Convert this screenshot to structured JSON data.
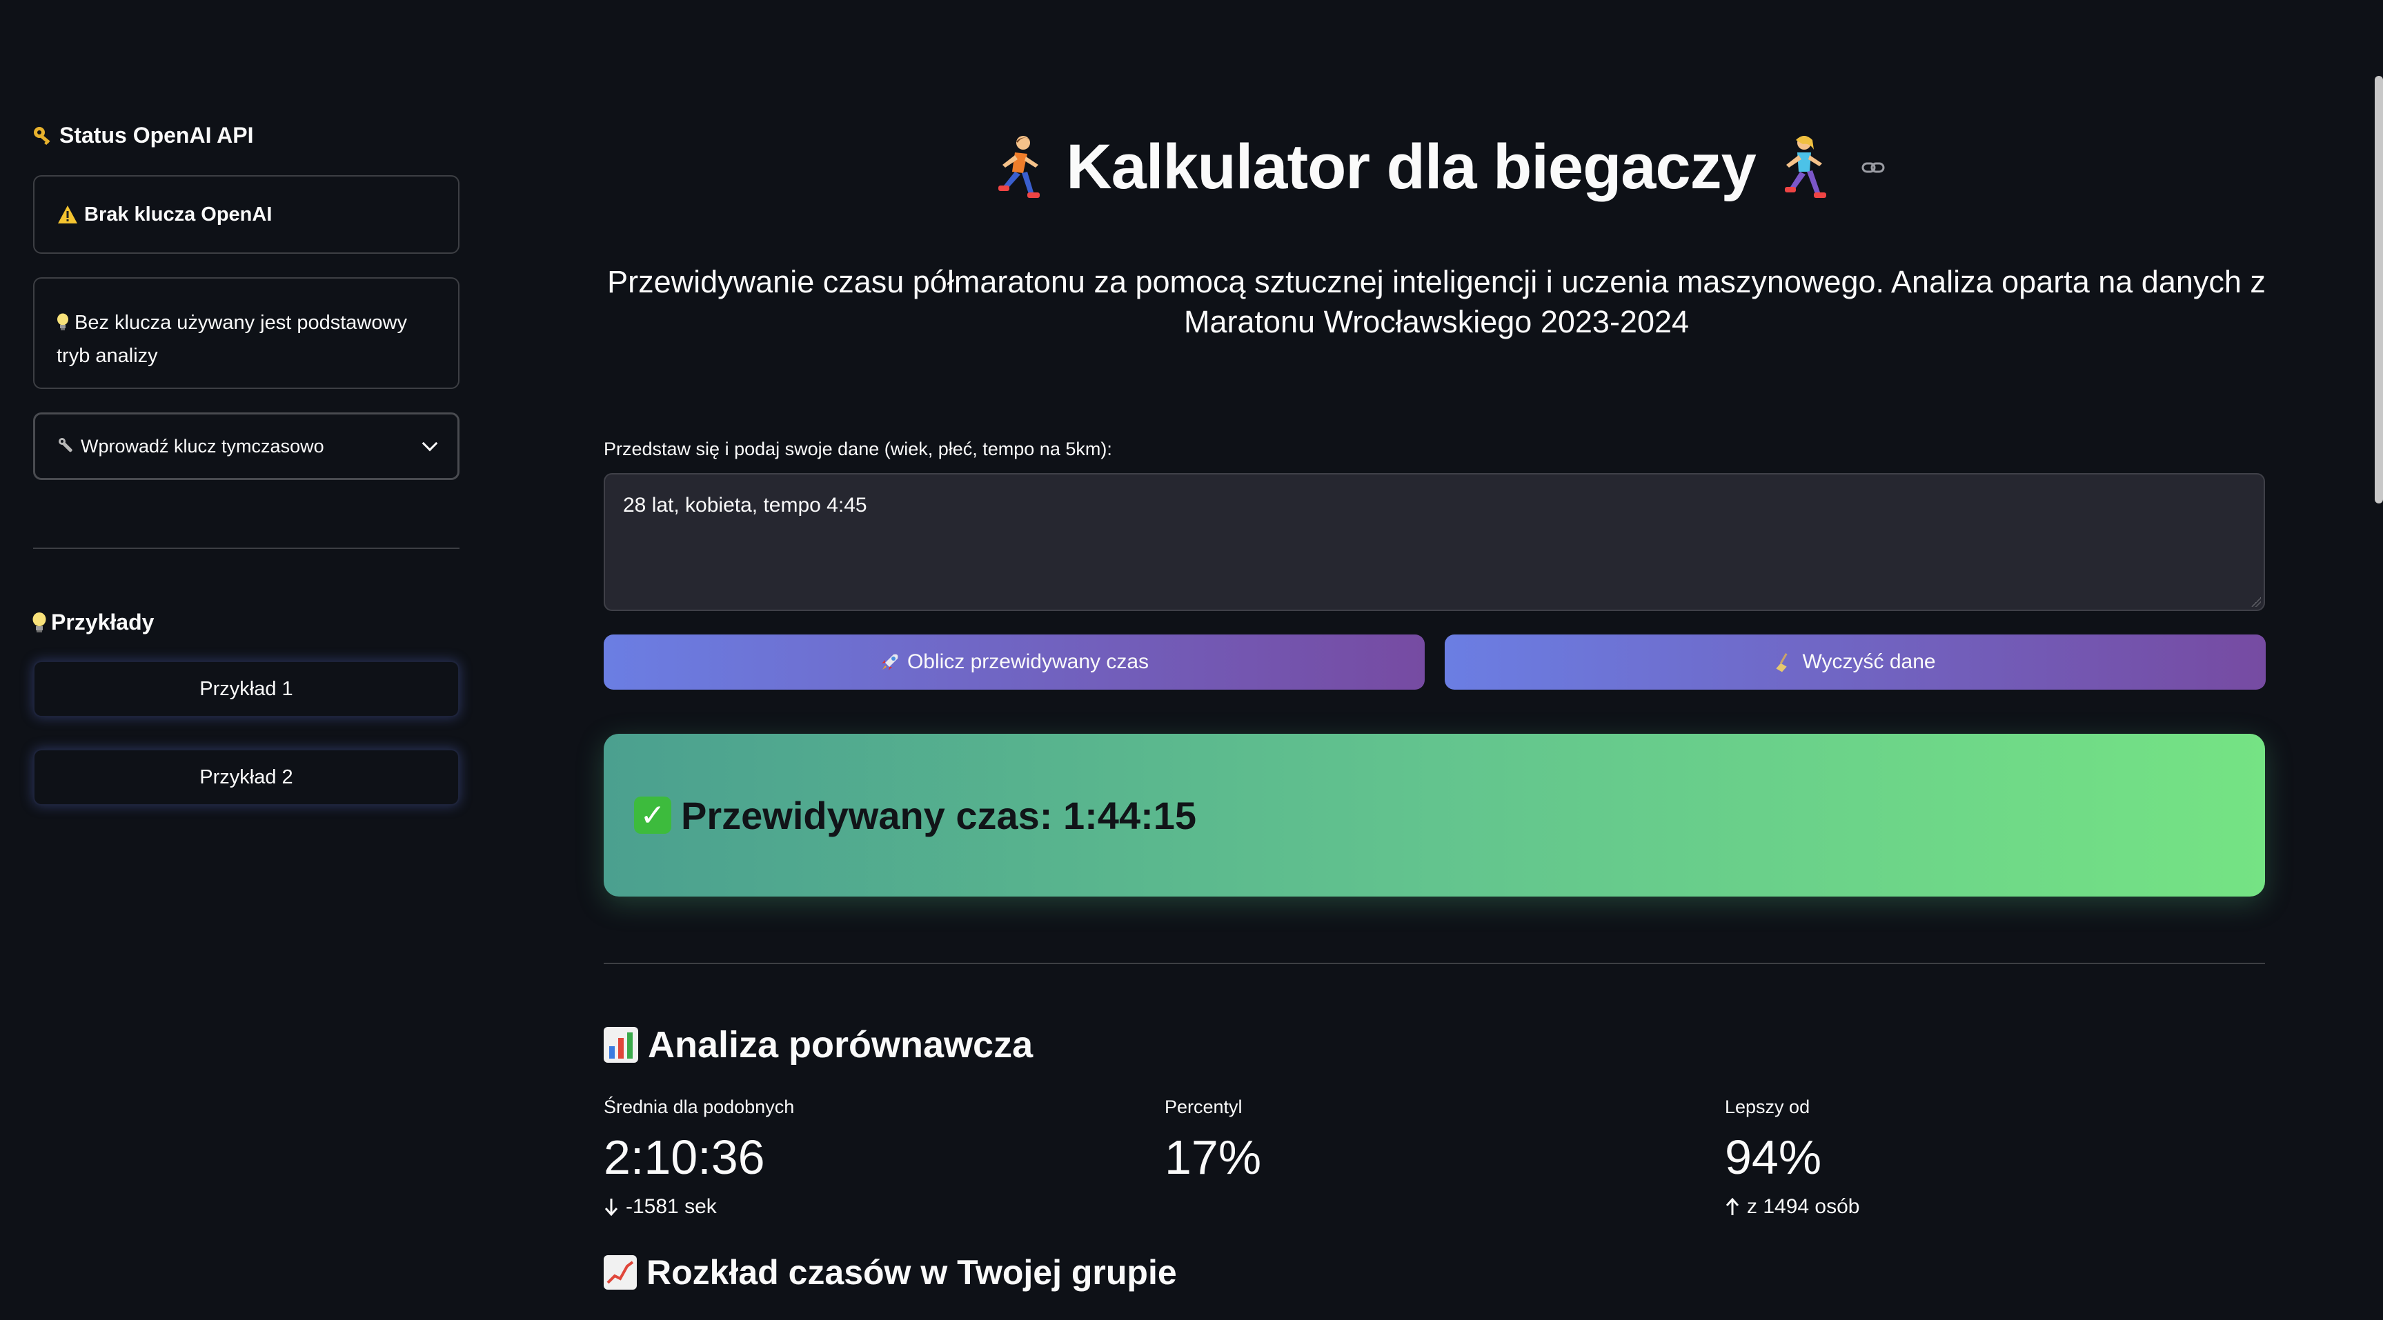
{
  "sidebar": {
    "api_status_header": "Status OpenAI API",
    "api_status_icon": "key-icon",
    "warning_text": "Brak klucza OpenAI",
    "warning_icon": "warning-icon",
    "tip_text": "Bez klucza używany jest podstawowy tryb analizy",
    "tip_icon": "lightbulb-icon",
    "expander_label": "Wprowadź klucz tymczasowo",
    "expander_icon": "wrench-icon",
    "examples_header": "Przykłady",
    "examples_icon": "lightbulb-icon",
    "examples": [
      {
        "label": "Przykład 1"
      },
      {
        "label": "Przykład 2"
      }
    ]
  },
  "header": {
    "title": "Kalkulator dla biegaczy",
    "subtitle": "Przewidywanie czasu półmaratonu za pomocą sztucznej inteligencji i uczenia maszynowego. Analiza oparta na danych z Maratonu Wrocławskiego 2023-2024"
  },
  "form": {
    "label": "Przedstaw się i podaj swoje dane (wiek, płeć, tempo na 5km):",
    "value": "28 lat, kobieta, tempo 4:45",
    "calculate_label": "Oblicz przewidywany czas",
    "clear_label": "Wyczyść dane"
  },
  "result": {
    "text": "Przewidywany czas: 1:44:15"
  },
  "analysis": {
    "title": "Analiza porównawcza",
    "metrics": [
      {
        "label": "Średnia dla podobnych",
        "value": "2:10:36",
        "delta": "-1581 sek",
        "delta_direction": "down"
      },
      {
        "label": "Percentyl",
        "value": "17%",
        "delta": "",
        "delta_direction": ""
      },
      {
        "label": "Lepszy od",
        "value": "94%",
        "delta": "z 1494 osób",
        "delta_direction": "up"
      }
    ]
  },
  "distribution": {
    "title": "Rozkład czasów w Twojej grupie"
  },
  "colors": {
    "background": "#0e1117",
    "button_gradient_start": "#6b7ee3",
    "button_gradient_end": "#764ba2",
    "result_gradient_start": "#4ba08f",
    "result_gradient_end": "#75e384"
  }
}
